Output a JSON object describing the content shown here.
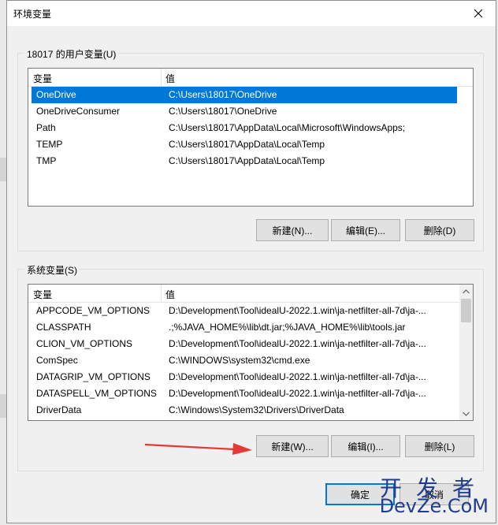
{
  "window": {
    "title": "环境变量"
  },
  "user_vars": {
    "group_title": "18017 的用户变量(U)",
    "columns": [
      "变量",
      "值"
    ],
    "rows": [
      {
        "name": "OneDrive",
        "value": "C:\\Users\\18017\\OneDrive"
      },
      {
        "name": "OneDriveConsumer",
        "value": "C:\\Users\\18017\\OneDrive"
      },
      {
        "name": "Path",
        "value": "C:\\Users\\18017\\AppData\\Local\\Microsoft\\WindowsApps;"
      },
      {
        "name": "TEMP",
        "value": "C:\\Users\\18017\\AppData\\Local\\Temp"
      },
      {
        "name": "TMP",
        "value": "C:\\Users\\18017\\AppData\\Local\\Temp"
      }
    ],
    "buttons": {
      "new": "新建(N)...",
      "edit": "编辑(E)...",
      "delete": "删除(D)"
    }
  },
  "system_vars": {
    "group_title": "系统变量(S)",
    "columns": [
      "变量",
      "值"
    ],
    "rows": [
      {
        "name": "APPCODE_VM_OPTIONS",
        "value": "D:\\Development\\Tool\\idealU-2022.1.win\\ja-netfilter-all-7d\\ja-..."
      },
      {
        "name": "CLASSPATH",
        "value": ".;%JAVA_HOME%\\lib\\dt.jar;%JAVA_HOME%\\lib\\tools.jar"
      },
      {
        "name": "CLION_VM_OPTIONS",
        "value": "D:\\Development\\Tool\\idealU-2022.1.win\\ja-netfilter-all-7d\\ja-..."
      },
      {
        "name": "ComSpec",
        "value": "C:\\WINDOWS\\system32\\cmd.exe"
      },
      {
        "name": "DATAGRIP_VM_OPTIONS",
        "value": "D:\\Development\\Tool\\idealU-2022.1.win\\ja-netfilter-all-7d\\ja-..."
      },
      {
        "name": "DATASPELL_VM_OPTIONS",
        "value": "D:\\Development\\Tool\\idealU-2022.1.win\\ja-netfilter-all-7d\\ja-..."
      },
      {
        "name": "DriverData",
        "value": "C:\\Windows\\System32\\Drivers\\DriverData"
      }
    ],
    "buttons": {
      "new": "新建(W)...",
      "edit": "编辑(I)...",
      "delete": "删除(L)"
    }
  },
  "footer": {
    "ok": "确定",
    "cancel": "取消"
  },
  "watermark": {
    "top": "开发者",
    "bottom": "DevZe.CoM"
  },
  "colors": {
    "selection": "#0078d7",
    "arrow": "#e53935",
    "watermark": "#1f3c8f"
  }
}
